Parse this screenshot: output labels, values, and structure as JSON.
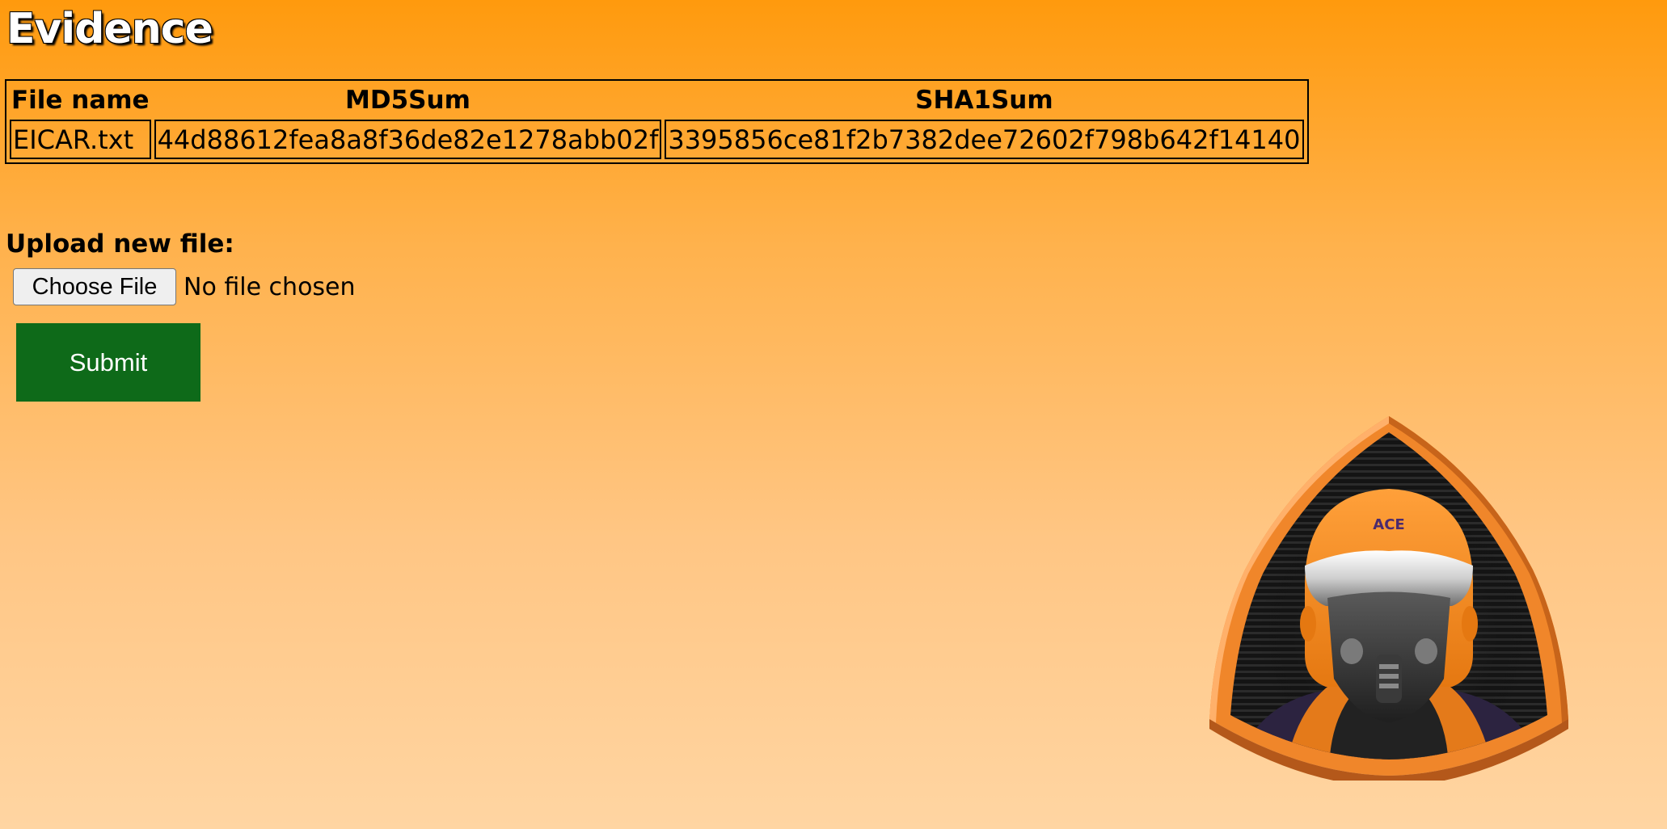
{
  "page": {
    "title": "Evidence"
  },
  "table": {
    "headers": [
      "File name",
      "MD5Sum",
      "SHA1Sum"
    ],
    "rows": [
      [
        "EICAR.txt",
        "44d88612fea8a8f36de82e1278abb02f",
        "3395856ce81f2b7382dee72602f798b642f14140"
      ]
    ]
  },
  "upload": {
    "label": "Upload new file:",
    "choose_file_label": "Choose File",
    "file_status": "No file chosen",
    "submit_label": "Submit"
  },
  "logo": {
    "text": "ACE",
    "icon": "ace-pilot-emblem"
  },
  "colors": {
    "background_top": "#ff9a0d",
    "background_bottom": "#ffd5a2",
    "submit_button": "#0e6a19",
    "logo_accent": "#f08a24"
  }
}
